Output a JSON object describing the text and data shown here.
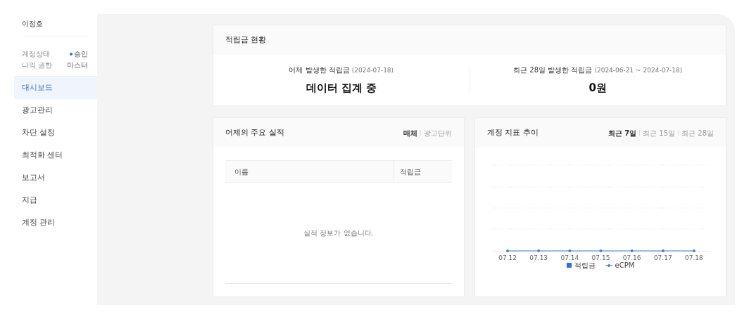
{
  "sidebar": {
    "user_name": "이정호",
    "info": [
      {
        "label": "계정상태",
        "value": "승인",
        "kind": "status",
        "color": "#2f6fde"
      },
      {
        "label": "나의 권한",
        "value": "마스터",
        "kind": "text"
      }
    ],
    "items": [
      {
        "label": "대시보드",
        "selected": true
      },
      {
        "label": "광고관리",
        "selected": false
      },
      {
        "label": "차단 설정",
        "selected": false
      },
      {
        "label": "최적화 센터",
        "selected": false
      },
      {
        "label": "보고서",
        "selected": false
      },
      {
        "label": "지급",
        "selected": false
      },
      {
        "label": "계정 관리",
        "selected": false
      }
    ]
  },
  "summary": {
    "title": "적립금 현황",
    "stats": [
      {
        "label": "어제 발생한 적립금",
        "period": "(2024-07-18)",
        "value": "데이터 집계 중"
      },
      {
        "label": "최근 28일 발생한 적립금",
        "period": "(2024-06-21 ~ 2024-07-18)",
        "value": "0원"
      }
    ]
  },
  "performance": {
    "title": "어제의 주요 실적",
    "tabs": [
      {
        "label": "매체",
        "selected": true
      },
      {
        "label": "광고단위",
        "selected": false
      }
    ],
    "table": {
      "columns": [
        "이름",
        "적립금"
      ],
      "empty_message": "실적 정보가 없습니다."
    }
  },
  "trend": {
    "title": "계정 지표 추이",
    "tabs": [
      {
        "label": "최근 7일",
        "selected": true
      },
      {
        "label": "최근 15일",
        "selected": false
      },
      {
        "label": "최근 28일",
        "selected": false
      }
    ],
    "axis_labels": [
      "07.12",
      "07.13",
      "07.14",
      "07.15",
      "07.16",
      "07.17",
      "07.18"
    ],
    "legend": [
      {
        "name": "적립금",
        "kind": "swatch",
        "color": "#2f6fde"
      },
      {
        "name": "eCPM",
        "kind": "line",
        "color": "#4a80d0"
      }
    ]
  }
}
